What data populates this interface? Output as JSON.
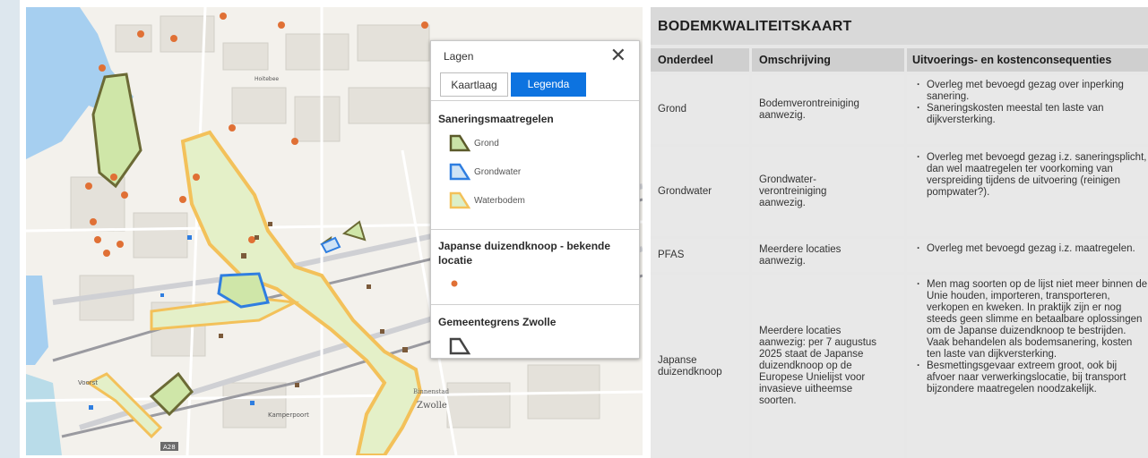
{
  "map": {
    "labels": {
      "hoiteboer": "Hoitebee",
      "voorst": "Voorst",
      "kamperpoort": "Kamperpoort",
      "binnenstad": "Binnenstad",
      "zwolle": "Zwolle",
      "a28": "A28"
    }
  },
  "legend": {
    "title": "Lagen",
    "close_icon": "close-icon",
    "tabs": [
      {
        "label": "Kaartlaag",
        "active": false
      },
      {
        "label": "Legenda",
        "active": true
      }
    ],
    "sections": [
      {
        "title": "Saneringsmaatregelen",
        "items": [
          {
            "label": "Grond",
            "color": "#5b5a2a",
            "fill": "#c9e2a6"
          },
          {
            "label": "Grondwater",
            "color": "#2f7ee0",
            "fill": "#cfe3f5"
          },
          {
            "label": "Waterbodem",
            "color": "#f3c15a",
            "fill": "#dcefc8"
          }
        ]
      },
      {
        "title": "Japanse duizendknoop - bekende locatie",
        "marker_color": "#e07035"
      },
      {
        "title": "Gemeentegrens Zwolle",
        "outline_color": "#444444"
      }
    ]
  },
  "table": {
    "title": "BODEMKWALITEITSKAART",
    "headers": [
      "Onderdeel",
      "Omschrijving",
      "Uitvoerings- en kostenconsequenties"
    ],
    "rows": [
      {
        "onderdeel": "Grond",
        "omschrijving": "Bodemverontreiniging aanwezig.",
        "consequenties": [
          "Overleg met bevoegd gezag over inperking sanering.",
          "Saneringskosten meestal ten laste van dijkversterking."
        ]
      },
      {
        "onderdeel": "Grondwater",
        "omschrijving": "Grondwater-verontreiniging aanwezig.",
        "consequenties": [
          "Overleg met bevoegd gezag i.z. saneringsplicht, dan wel maatregelen ter voorkoming van verspreiding tijdens de uitvoering (reinigen pompwater?)."
        ]
      },
      {
        "onderdeel": "PFAS",
        "omschrijving": "Meerdere locaties aanwezig.",
        "consequenties": [
          "Overleg met bevoegd gezag i.z. maatregelen."
        ]
      },
      {
        "onderdeel": "Japanse duizendknoop",
        "omschrijving": "Meerdere locaties aanwezig: per 7 augustus 2025 staat de Japanse duizendknoop op de Europese Unielijst voor invasieve uitheemse soorten.",
        "consequenties": [
          "Men mag soorten op de lijst niet meer binnen de Unie houden, importeren, transporteren, verkopen en kweken. In praktijk zijn er nog steeds geen slimme en betaalbare oplossingen om de Japanse duizendknoop te bestrijden. Vaak behandelen als bodemsanering, kosten ten laste van dijkversterking.",
          "Besmettingsgevaar extreem groot, ook bij afvoer naar verwerkingslocatie, bij transport bijzondere maatregelen noodzakelijk."
        ]
      }
    ]
  }
}
